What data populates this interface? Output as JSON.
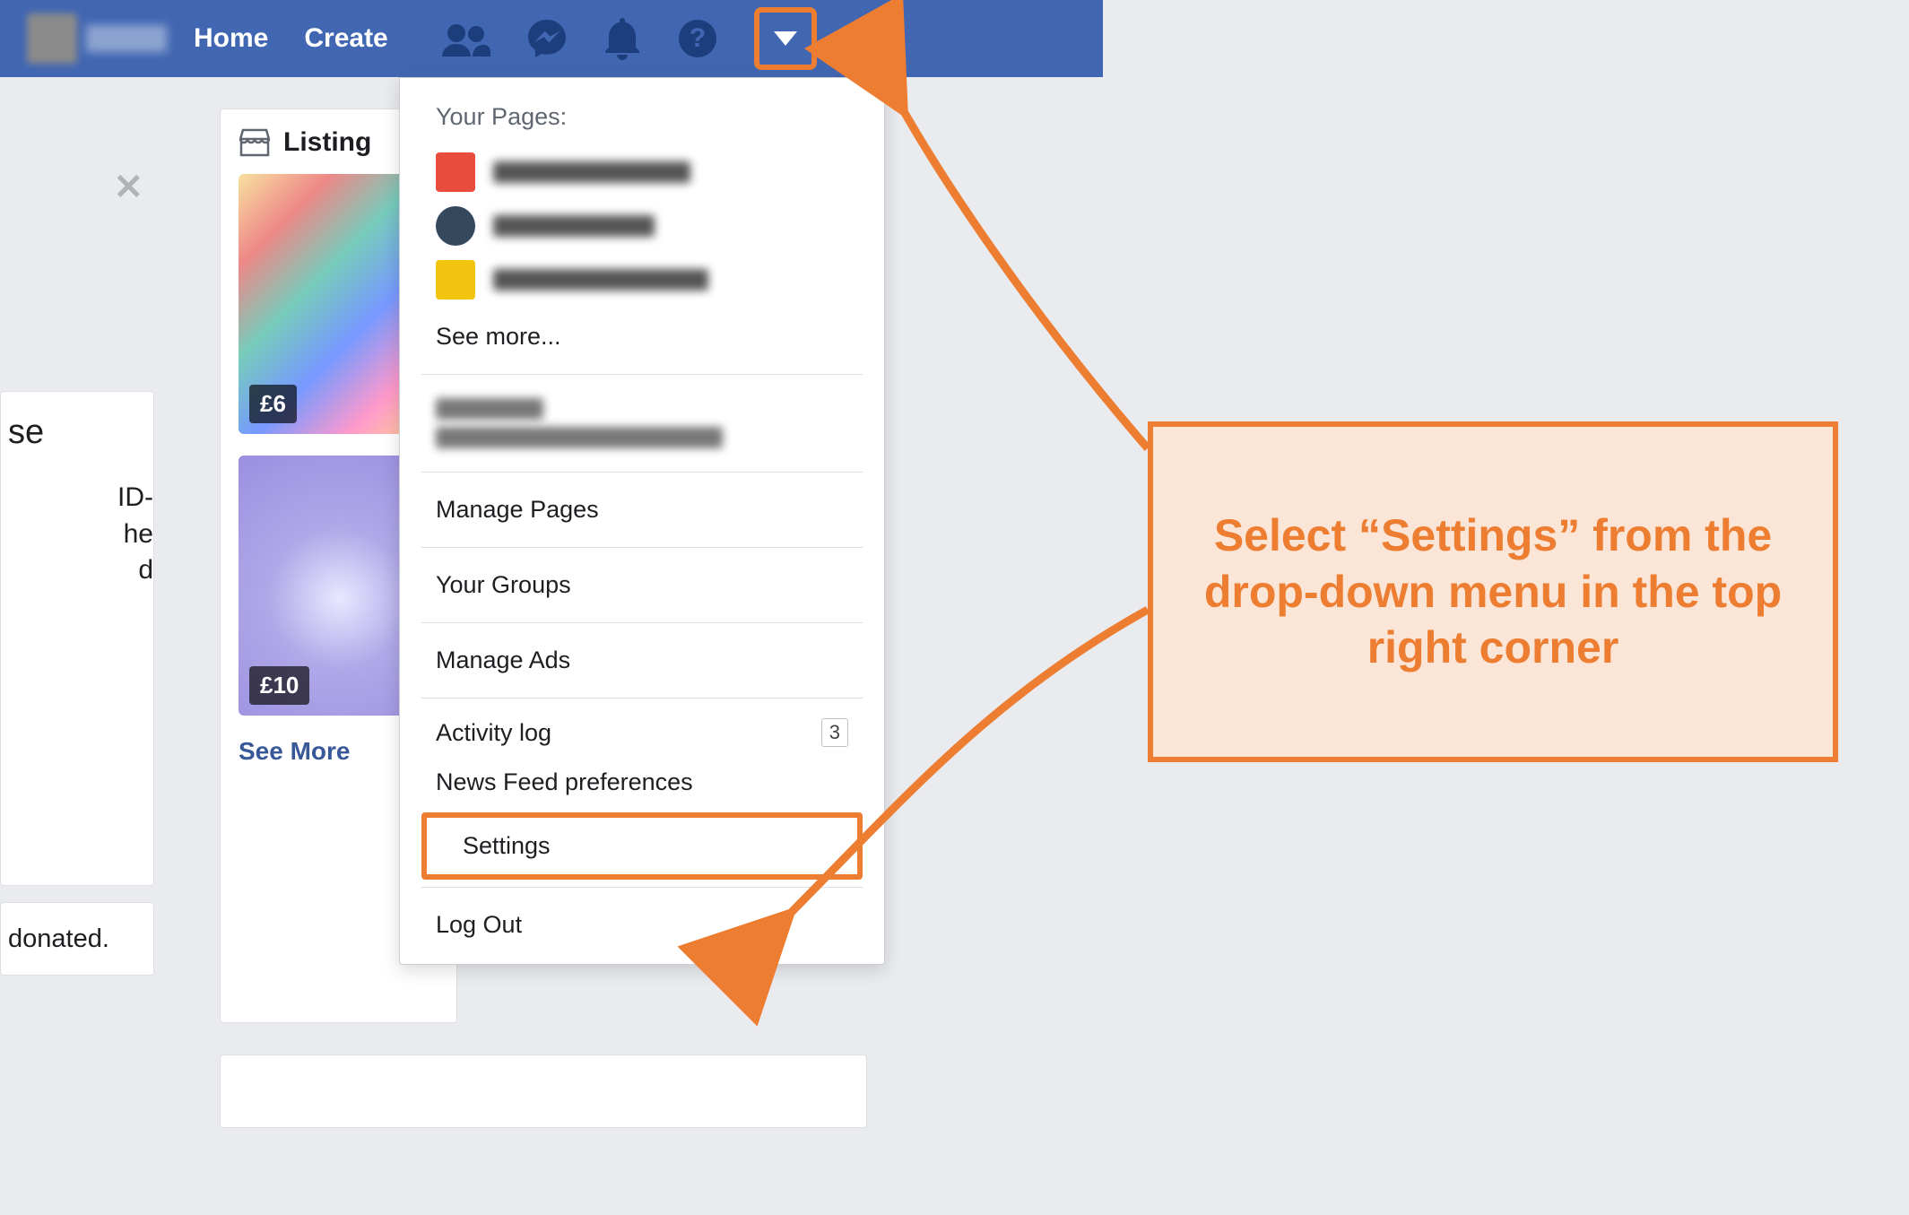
{
  "topbar": {
    "home": "Home",
    "create": "Create"
  },
  "leftFragment": {
    "se": "se",
    "lines": "ID-\nhe\nd",
    "donated": " donated."
  },
  "listingCard": {
    "title": "Listing",
    "price1": "£6",
    "price2": "£10",
    "seeMore": "See More"
  },
  "menu": {
    "yourPagesLabel": "Your Pages:",
    "seeMore": "See more...",
    "managePages": "Manage Pages",
    "yourGroups": "Your Groups",
    "manageAds": "Manage Ads",
    "activityLog": "Activity log",
    "activityBadge": "3",
    "newsFeedPrefs": "News Feed preferences",
    "settings": "Settings",
    "logOut": "Log Out"
  },
  "callout": {
    "text": "Select “Settings” from the drop-down menu in the top right corner"
  }
}
